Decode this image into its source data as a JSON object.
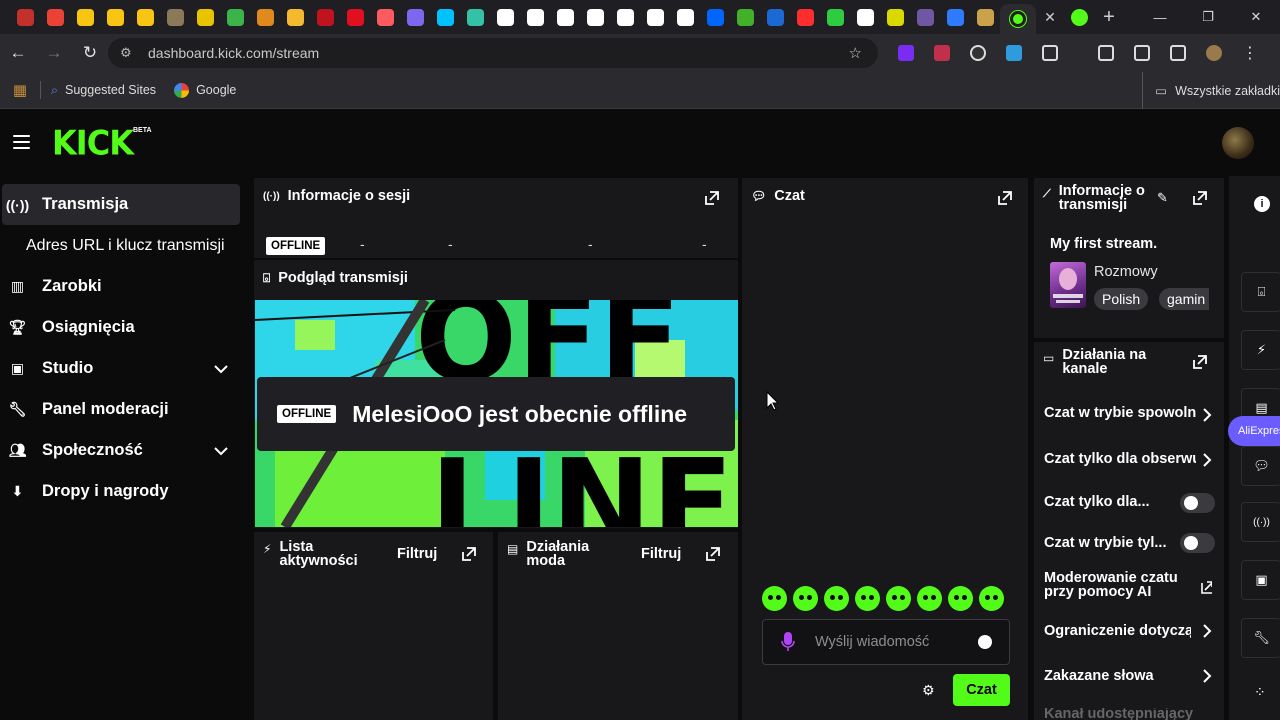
{
  "browser": {
    "url": "dashboard.kick.com/stream",
    "bookmarks": [
      {
        "label": "Suggested Sites"
      },
      {
        "label": "Google"
      }
    ],
    "all_bookmarks": "Wszystkie zakładki",
    "tab_favicon_colors": [
      "#c4302b",
      "#ea4335",
      "#f9c513",
      "#f9c513",
      "#f9c513",
      "#8a7a5a",
      "#e8c400",
      "#3bb54a",
      "#e08a1e",
      "#f3ba2f",
      "#c1121f",
      "#e01020",
      "#ff5a5f",
      "#7b68ee",
      "#00c2ff",
      "#33c2a6",
      "#ffffff",
      "#ffffff",
      "#ffffff",
      "#ffffff",
      "#ffffff",
      "#ffffff",
      "#ffffff",
      "#0066ff",
      "#43b02a",
      "#1c69d4",
      "#ff2d2d",
      "#2ecc40",
      "#ffffff",
      "#d9d900",
      "#7056a3",
      "#2e7bff",
      "#c9a24a"
    ]
  },
  "brand": {
    "logo": "KICK",
    "beta": "BETA",
    "accent": "#53fc18"
  },
  "sidebar": {
    "items": [
      {
        "label": "Transmisja",
        "icon": "broadcast-icon",
        "active": true
      },
      {
        "label": "Adres URL i klucz transmisji",
        "icon": "",
        "sub": true
      },
      {
        "label": "Zarobki",
        "icon": "chart-icon"
      },
      {
        "label": "Osiągnięcia",
        "icon": "trophy-icon"
      },
      {
        "label": "Studio",
        "icon": "studio-icon",
        "expandable": true
      },
      {
        "label": "Panel moderacji",
        "icon": "wrench-icon"
      },
      {
        "label": "Społeczność",
        "icon": "community-icon",
        "expandable": true
      },
      {
        "label": "Dropy i nagrody",
        "icon": "drops-icon"
      }
    ]
  },
  "session": {
    "title": "Informacje o sesji",
    "status": "OFFLINE",
    "stats": [
      "-",
      "-",
      "-",
      "-"
    ]
  },
  "preview": {
    "title": "Podgląd transmisji",
    "badge": "OFFLINE",
    "message": "MelesiOoO jest obecnie offline"
  },
  "activity": {
    "title": "Lista aktywności",
    "filter": "Filtruj"
  },
  "modactions": {
    "title": "Działania moda",
    "filter": "Filtruj"
  },
  "chat": {
    "title": "Czat",
    "placeholder": "Wyślij wiadomość",
    "send": "Czat",
    "emotes": [
      "emote-1",
      "emote-2",
      "emote-3",
      "emote-4",
      "emote-5",
      "emote-6",
      "emote-7",
      "emote-8"
    ]
  },
  "stream_info": {
    "title": "Informacje o transmisji",
    "stream_title": "My first stream.",
    "category": "Rozmowy",
    "tags": [
      "Polish",
      "gamin"
    ]
  },
  "channel_actions": {
    "title": "Działania na kanale",
    "rows": [
      {
        "label": "Czat w trybie spowolnionym",
        "control": "chevron"
      },
      {
        "label": "Czat tylko dla obserwujących",
        "control": "chevron"
      },
      {
        "label": "Czat tylko dla...",
        "control": "toggle",
        "on": false
      },
      {
        "label": "Czat w trybie tyl...",
        "control": "toggle",
        "on": false
      },
      {
        "label": "Moderowanie czatu przy pomocy AI",
        "control": "external"
      },
      {
        "label": "Ograniczenie dotyczące",
        "control": "chevron"
      },
      {
        "label": "Zakazane słowa",
        "control": "chevron"
      },
      {
        "label": "Kanał udostępniający",
        "control": "none"
      }
    ]
  },
  "rail": {
    "items": [
      "info-icon",
      "preview-icon",
      "bolt-icon",
      "list-icon",
      "chat-icon",
      "broadcast-icon",
      "camera-icon",
      "wrench-icon",
      "apps-icon"
    ],
    "aliexpress_label": "AliExpress"
  }
}
